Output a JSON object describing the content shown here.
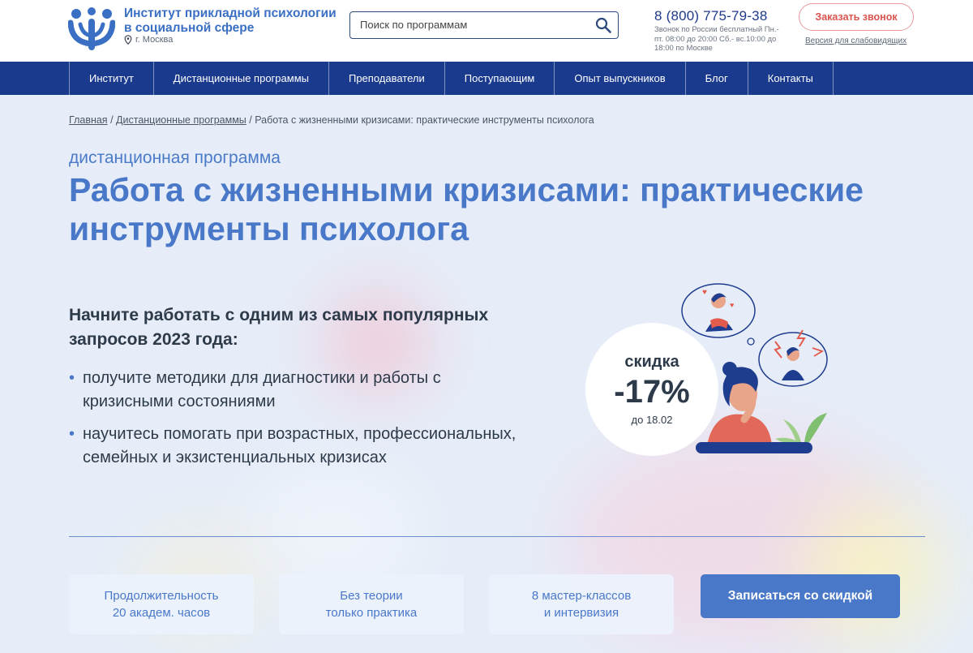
{
  "header": {
    "logo_title": "Институт прикладной психологии в социальной сфере",
    "city": "г. Москва",
    "search_placeholder": "Поиск по программам",
    "phone": "8 (800) 775-79-38",
    "phone_note": "Звонок по России бесплатный Пн.- пт. 08:00 до 20:00 Сб.- вс.10:00 до 18:00 по Москве",
    "callback_label": "Заказать звонок",
    "accessibility_label": "Версия для слабовидящих"
  },
  "nav": {
    "items": [
      "Институт",
      "Дистанционные программы",
      "Преподаватели",
      "Поступающим",
      "Опыт выпускников",
      "Блог",
      "Контакты"
    ]
  },
  "breadcrumb": {
    "home": "Главная",
    "section": "Дистанционные программы",
    "current": "Работа с жизненными кризисами: практические инструменты психолога",
    "separator": "/"
  },
  "hero": {
    "kicker": "дистанционная программа",
    "title": "Работа с жизненными кризисами: практические инструменты психолога",
    "lead": "Начните работать с одним из самых популярных запросов 2023 года:",
    "bullets": [
      "получите методики для диагностики и работы с кризисными состояниями",
      "научитесь помогать при возрастных, профессиональных, семейных и экзистенциальных кризисах"
    ]
  },
  "discount": {
    "label": "скидка",
    "value": "-17%",
    "until": "до 18.02"
  },
  "features": [
    {
      "line1": "Продолжительность",
      "line2": "20 академ. часов"
    },
    {
      "line1": "Без теории",
      "line2": "только практика"
    },
    {
      "line1": "8 мастер-классов",
      "line2": "и интервизия"
    }
  ],
  "cta_label": "Записаться со скидкой",
  "colors": {
    "brand_blue": "#4a78c8",
    "nav_blue": "#1a3a8e",
    "accent_red": "#d9534f",
    "background": "#e6edf8"
  }
}
